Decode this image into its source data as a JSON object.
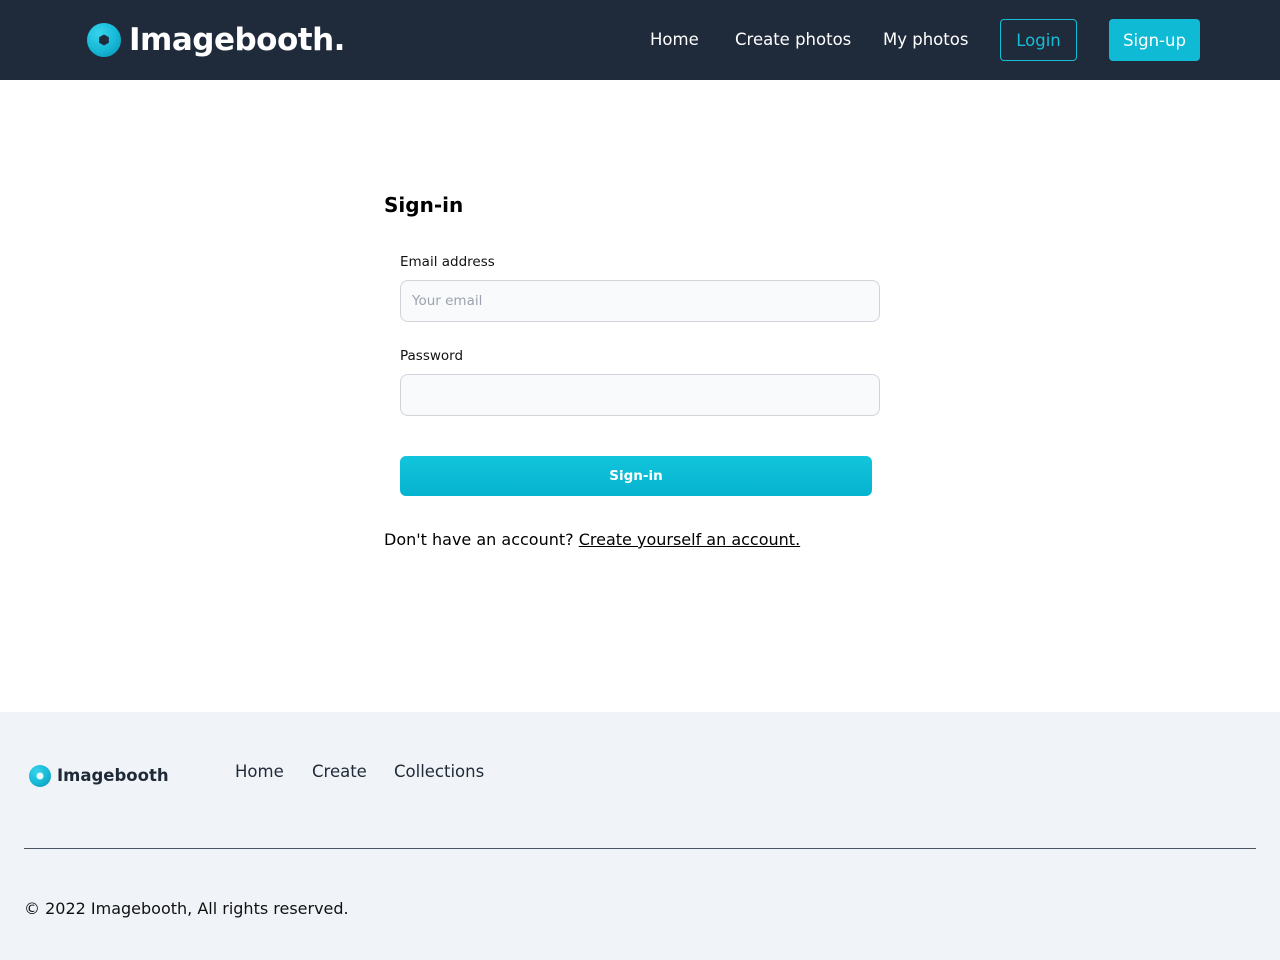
{
  "header": {
    "brand_name": "Imagebooth.",
    "nav": {
      "home": "Home",
      "create_photos": "Create photos",
      "my_photos": "My photos"
    },
    "login_label": "Login",
    "signup_label": "Sign-up"
  },
  "signin": {
    "title": "Sign-in",
    "email_label": "Email address",
    "email_placeholder": "Your email",
    "email_value": "",
    "password_label": "Password",
    "password_value": "",
    "submit_label": "Sign-in",
    "no_account_text": "Don't have an account?",
    "create_account_link": "Create yourself an account."
  },
  "footer": {
    "brand_name": "Imagebooth",
    "links": {
      "home": "Home",
      "create": "Create",
      "collections": "Collections"
    },
    "copyright": "© 2022 Imagebooth, All rights reserved."
  },
  "colors": {
    "header_bg": "#1f2a3a",
    "accent": "#0fbad5",
    "footer_bg": "#f0f4f8"
  },
  "icons": {
    "brand_logo": "hexagon-in-circle-logo-icon",
    "footer_logo": "circle-logo-icon"
  }
}
